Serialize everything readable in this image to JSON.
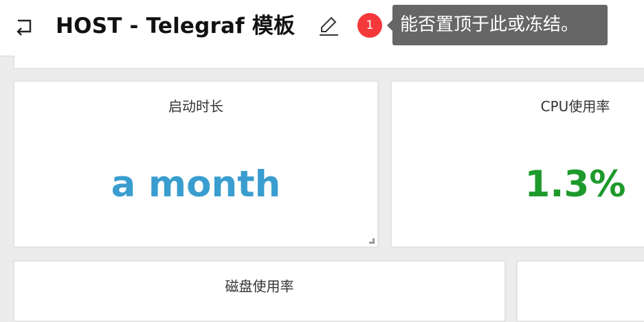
{
  "header": {
    "title": "HOST - Telegraf 模板",
    "notification_count": "1",
    "tooltip": "能否置顶于此或冻结。"
  },
  "panels": [
    {
      "title": "启动时长",
      "value": "a month",
      "color": "#3a9dcf"
    },
    {
      "title": "CPU使用率",
      "value": "1.3%",
      "color": "#1e9a2c"
    },
    {
      "title": "磁盘使用率"
    }
  ],
  "icons": [
    "back-icon",
    "edit-pencil-icon",
    "resize-handle-icon"
  ]
}
